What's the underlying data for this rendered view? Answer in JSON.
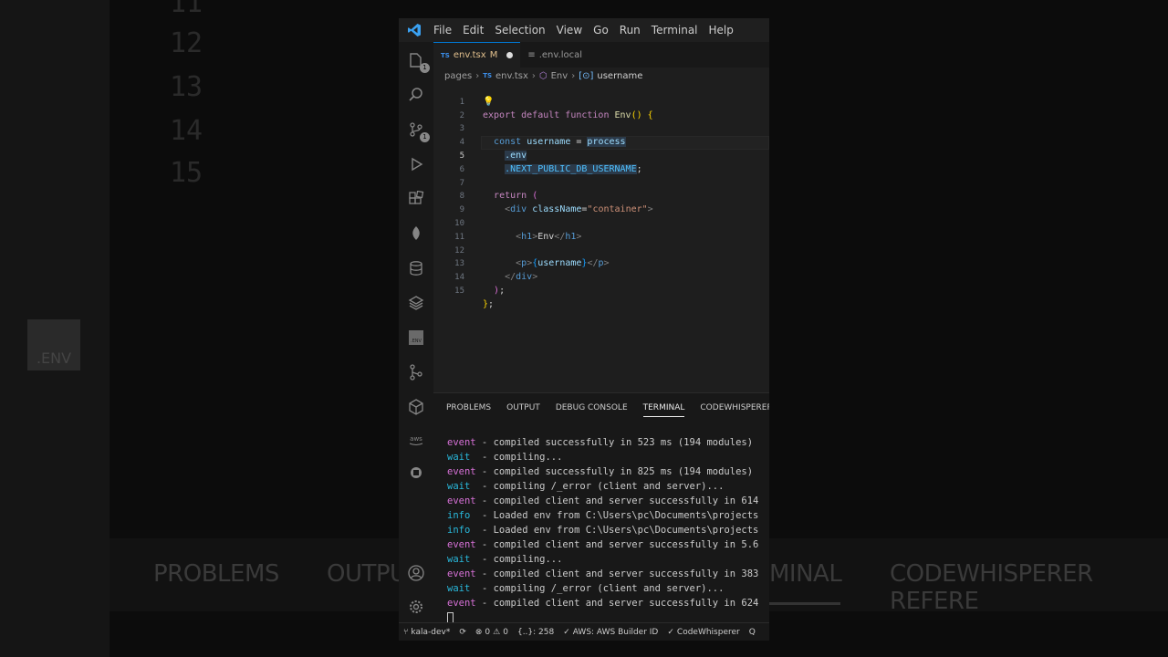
{
  "colors": {
    "accent": "#0078d4",
    "event": "#d670d6",
    "wait": "#29b8db",
    "keyword": "#c586c0",
    "function": "#dcdcaa"
  },
  "menu": [
    "File",
    "Edit",
    "Selection",
    "View",
    "Go",
    "Run",
    "Terminal",
    "Help"
  ],
  "tabs": [
    {
      "icon": "TS",
      "label": "env.tsx",
      "status": "M"
    },
    {
      "icon": "env-file-icon",
      "label": ".env.local"
    }
  ],
  "breadcrumbs": [
    "pages",
    "env.tsx",
    "Env",
    "username"
  ],
  "code_lines": [
    {
      "n": "1",
      "text": "export default function Env() {"
    },
    {
      "n": "2",
      "text": ""
    },
    {
      "n": "3",
      "text": "  const username = process"
    },
    {
      "n": "4",
      "text": "    .env"
    },
    {
      "n": "5",
      "text": "    .NEXT_PUBLIC_DB_USERNAME;"
    },
    {
      "n": "6",
      "text": ""
    },
    {
      "n": "7",
      "text": "  return ("
    },
    {
      "n": "8",
      "text": "    <div className=\"container\">"
    },
    {
      "n": "9",
      "text": ""
    },
    {
      "n": "10",
      "text": "      <h1>Env</h1>"
    },
    {
      "n": "11",
      "text": ""
    },
    {
      "n": "12",
      "text": "      <p>{username}</p>"
    },
    {
      "n": "13",
      "text": "    </div>"
    },
    {
      "n": "14",
      "text": "  );"
    },
    {
      "n": "15",
      "text": "};"
    }
  ],
  "panel_tabs": [
    "PROBLEMS",
    "OUTPUT",
    "DEBUG CONSOLE",
    "TERMINAL",
    "CODEWHISPERER REFERE"
  ],
  "terminal": [
    {
      "level": "event",
      "text": " - compiled successfully in 523 ms (194 modules)"
    },
    {
      "level": "wait",
      "text": "  - compiling..."
    },
    {
      "level": "event",
      "text": " - compiled successfully in 825 ms (194 modules)"
    },
    {
      "level": "wait",
      "text": "  - compiling /_error (client and server)..."
    },
    {
      "level": "event",
      "text": " - compiled client and server successfully in 614"
    },
    {
      "level": "info",
      "text": "  - Loaded env from C:\\Users\\pc\\Documents\\projects"
    },
    {
      "level": "info",
      "text": "  - Loaded env from C:\\Users\\pc\\Documents\\projects"
    },
    {
      "level": "event",
      "text": " - compiled client and server successfully in 5.6"
    },
    {
      "level": "wait",
      "text": "  - compiling..."
    },
    {
      "level": "event",
      "text": " - compiled client and server successfully in 383"
    },
    {
      "level": "wait",
      "text": "  - compiling /_error (client and server)..."
    },
    {
      "level": "event",
      "text": " - compiled client and server successfully in 624"
    }
  ],
  "status": {
    "branch": "kala-dev*",
    "errors": "0",
    "warnings": "0",
    "selection": "{..}: 258",
    "aws": "AWS: AWS Builder ID",
    "codewhisperer": "CodeWhisperer",
    "trailing": "Q"
  },
  "background": {
    "line_numbers": [
      "11",
      "12",
      "13",
      "14",
      "15"
    ],
    "tabs": [
      "PROBLEMS",
      "OUTPU",
      "MINAL",
      "CODEWHISPERER REFERE"
    ],
    "env_label": ".ENV"
  }
}
